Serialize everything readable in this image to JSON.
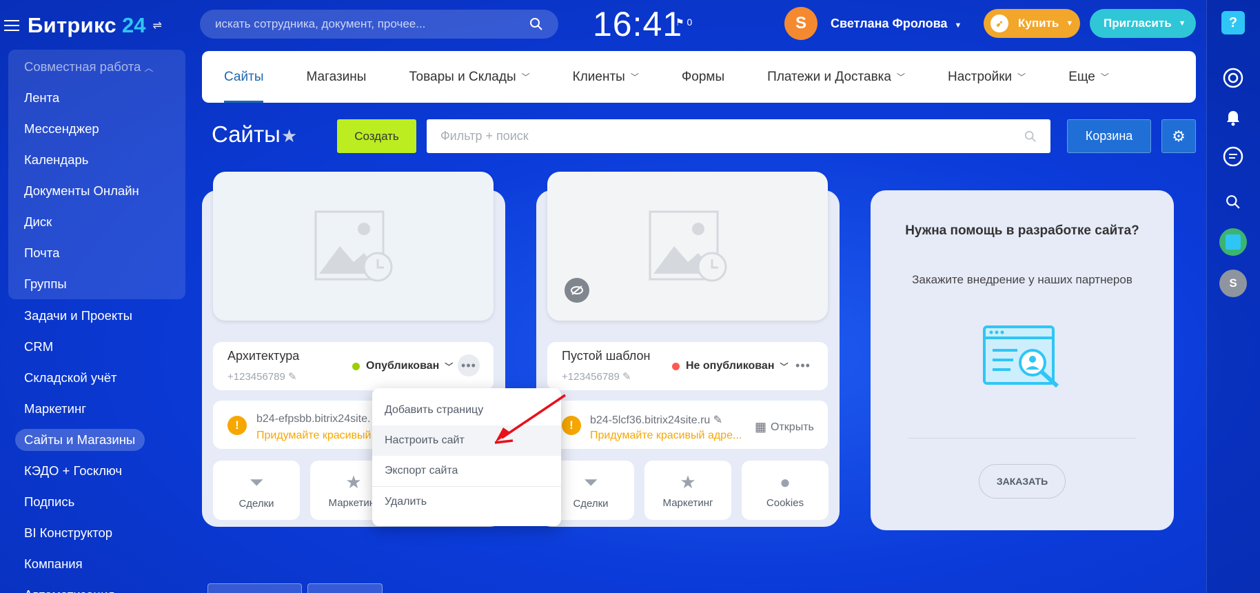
{
  "header": {
    "logo_text": "Битрикс",
    "logo_num": "24",
    "search_placeholder": "искать сотрудника, документ, прочее...",
    "clock": "16:41",
    "flag_count": "0",
    "user_initial": "S",
    "user_name": "Светлана Фролова",
    "buy_label": "Купить",
    "invite_label": "Пригласить"
  },
  "sidebar": {
    "group_label": "Совместная работа",
    "items": [
      {
        "label": "Лента"
      },
      {
        "label": "Мессенджер"
      },
      {
        "label": "Календарь"
      },
      {
        "label": "Документы Онлайн"
      },
      {
        "label": "Диск"
      },
      {
        "label": "Почта"
      },
      {
        "label": "Группы"
      },
      {
        "label": "Задачи и Проекты"
      },
      {
        "label": "CRM"
      },
      {
        "label": "Складской учёт"
      },
      {
        "label": "Маркетинг"
      },
      {
        "label": "Сайты и Магазины"
      },
      {
        "label": "КЭДО + Госключ"
      },
      {
        "label": "Подпись"
      },
      {
        "label": "BI Конструктор"
      },
      {
        "label": "Компания"
      },
      {
        "label": "Автоматизация"
      }
    ]
  },
  "nav": {
    "tabs": [
      {
        "label": "Сайты",
        "active": true
      },
      {
        "label": "Магазины"
      },
      {
        "label": "Товары и Склады"
      },
      {
        "label": "Клиенты"
      },
      {
        "label": "Формы"
      },
      {
        "label": "Платежи и Доставка"
      },
      {
        "label": "Настройки"
      },
      {
        "label": "Еще"
      }
    ]
  },
  "page": {
    "title": "Сайты",
    "create_label": "Создать",
    "filter_placeholder": "Фильтр + поиск",
    "cart_label": "Корзина"
  },
  "cards": [
    {
      "name": "Архитектура",
      "phone": "+123456789",
      "status": "Опубликован",
      "status_color": "#9dcf00",
      "url": "b24-efpsbb.bitrix24site.",
      "hint": "Придумайте красивый",
      "tiles": [
        {
          "label": "Сделки"
        },
        {
          "label": "Маркетинг"
        }
      ]
    },
    {
      "name": "Пустой шаблон",
      "phone": "+123456789",
      "status": "Не опубликован",
      "status_color": "#ff5752",
      "url": "b24-5lcf36.bitrix24site.ru",
      "hint": "Придумайте красивый адре...",
      "open_label": "Открыть",
      "tiles": [
        {
          "label": "Сделки"
        },
        {
          "label": "Маркетинг"
        },
        {
          "label": "Cookies"
        }
      ]
    }
  ],
  "promo": {
    "title": "Нужна помощь в разработке сайта?",
    "subtitle": "Закажите внедрение у наших партнеров",
    "order_label": "ЗАКАЗАТЬ"
  },
  "context_menu": {
    "items": [
      {
        "label": "Добавить страницу"
      },
      {
        "label": "Настроить сайт"
      },
      {
        "label": "Экспорт сайта"
      },
      {
        "label": "Удалить"
      }
    ]
  },
  "rail": {
    "avatar_initial": "S"
  },
  "colors": {
    "accent": "#2067b0",
    "create": "#bbed21",
    "buy": "#f2a62a",
    "invite": "#2fc6d8",
    "warning": "#f7a700"
  }
}
